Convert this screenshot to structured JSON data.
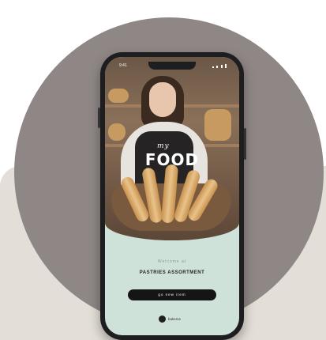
{
  "status_bar": {
    "time": "9:41"
  },
  "logo": {
    "small": "my",
    "big": "FOOD"
  },
  "welcome": "Welcome at",
  "headline": "PASTRIES ASSORTMENT",
  "cta_label": "go new item",
  "brand_label": "bakeme",
  "colors": {
    "circle": "#8f8785",
    "panel": "#e3ded7",
    "screen_bottom": "#cfe2da",
    "button": "#151515"
  }
}
